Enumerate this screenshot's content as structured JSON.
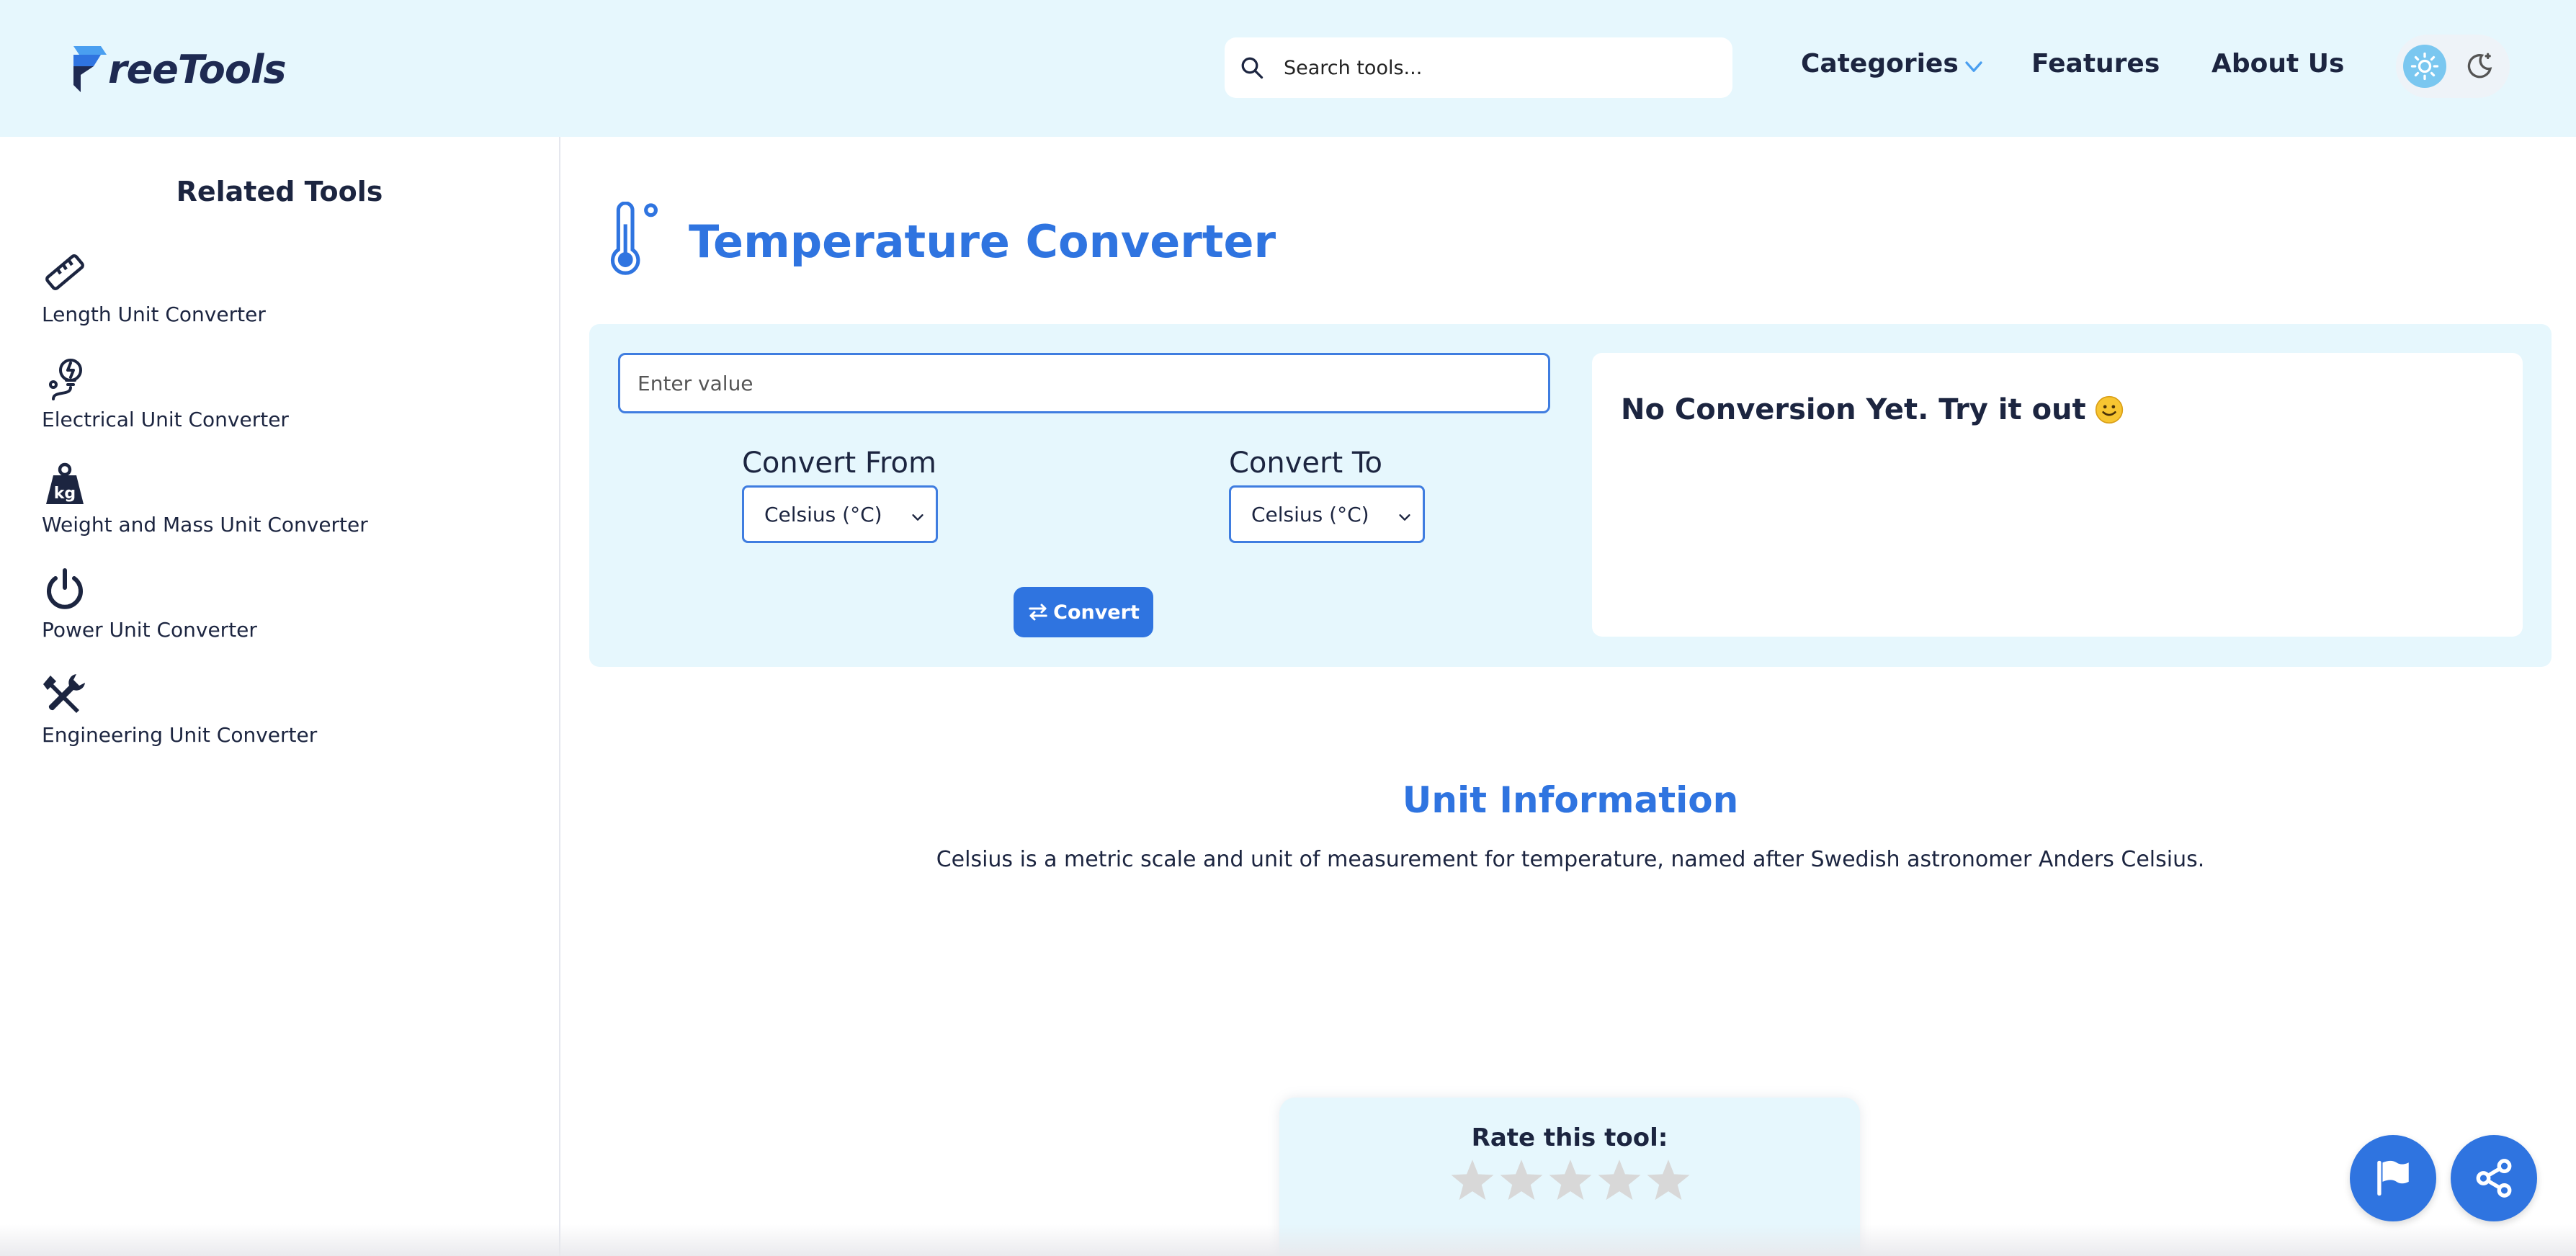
{
  "header": {
    "logo_text": "reeTools",
    "search_placeholder": "Search tools...",
    "nav": {
      "categories": "Categories",
      "features": "Features",
      "about": "About Us"
    },
    "theme_toggle": {
      "light_icon": "sun-icon",
      "dark_icon": "moon-icon"
    }
  },
  "sidebar": {
    "title": "Related Tools",
    "items": [
      {
        "label": "Length Unit Converter",
        "icon": "ruler-icon"
      },
      {
        "label": "Electrical Unit Converter",
        "icon": "electric-bulb-icon"
      },
      {
        "label": "Weight and Mass Unit Converter",
        "icon": "weight-kg-icon"
      },
      {
        "label": "Power Unit Converter",
        "icon": "power-icon"
      },
      {
        "label": "Engineering Unit Converter",
        "icon": "tools-icon"
      }
    ]
  },
  "main": {
    "title": "Temperature Converter",
    "title_icon": "thermometer-icon",
    "converter": {
      "value_placeholder": "Enter value",
      "from_label": "Convert From",
      "to_label": "Convert To",
      "from_selected": "Celsius (°C)",
      "to_selected": "Celsius (°C)",
      "convert_label": "Convert",
      "result_text": "No Conversion Yet. Try it out"
    },
    "unit_info": {
      "title": "Unit Information",
      "text": "Celsius is a metric scale and unit of measurement for temperature, named after Swedish astronomer Anders Celsius."
    },
    "rating": {
      "title": "Rate this tool:",
      "stars_total": 5,
      "stars_selected": 0
    }
  },
  "colors": {
    "accent": "#2f74e0",
    "header_bg": "#e6f7fd",
    "text_dark": "#1c2540",
    "star_empty": "#d8d8d8"
  }
}
